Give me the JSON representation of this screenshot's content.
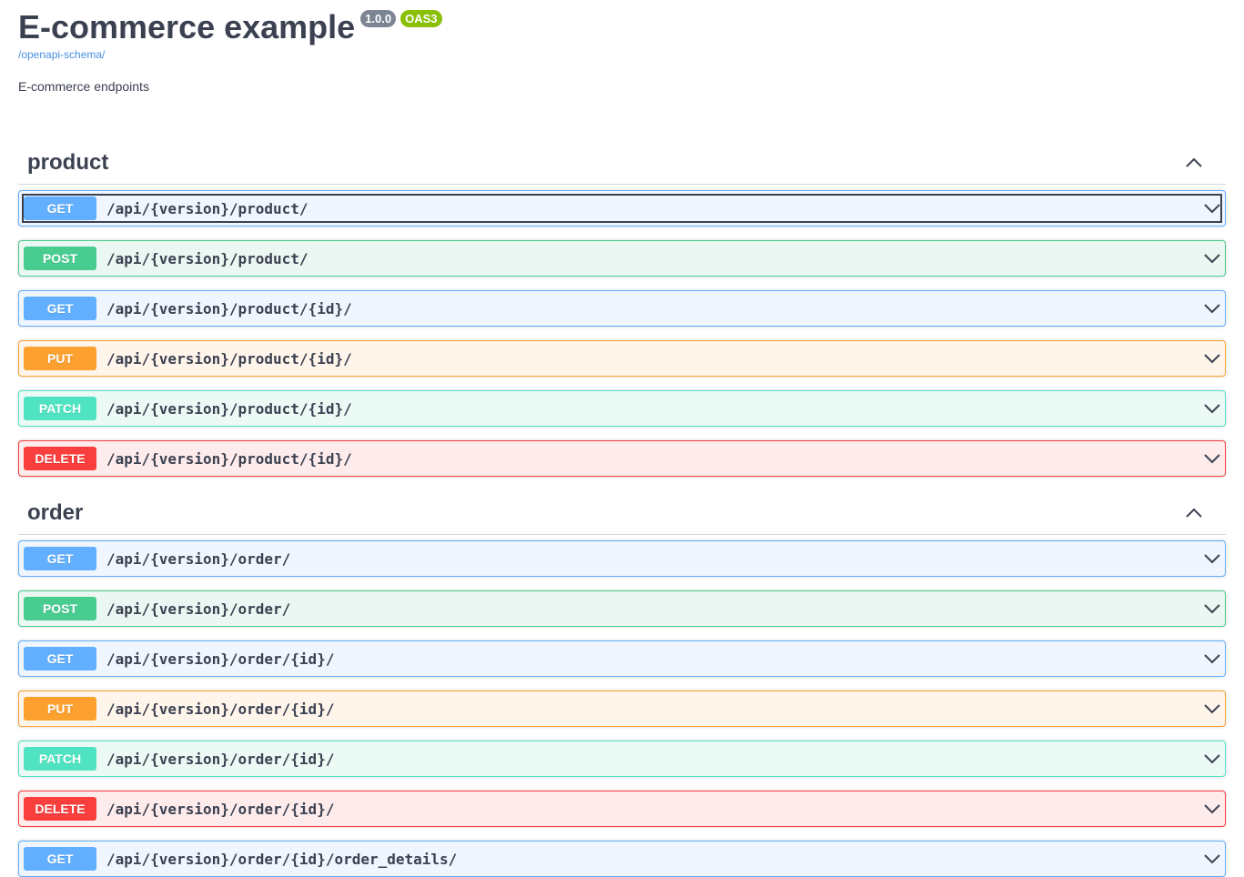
{
  "info": {
    "title": "E-commerce example",
    "version": "1.0.0",
    "oas": "OAS3",
    "schema_link": "/openapi-schema/",
    "description": "E-commerce endpoints"
  },
  "tags": [
    {
      "name": "product",
      "operations": [
        {
          "method": "GET",
          "path": "/api/{version}/product/"
        },
        {
          "method": "POST",
          "path": "/api/{version}/product/"
        },
        {
          "method": "GET",
          "path": "/api/{version}/product/{id}/"
        },
        {
          "method": "PUT",
          "path": "/api/{version}/product/{id}/"
        },
        {
          "method": "PATCH",
          "path": "/api/{version}/product/{id}/"
        },
        {
          "method": "DELETE",
          "path": "/api/{version}/product/{id}/"
        }
      ]
    },
    {
      "name": "order",
      "operations": [
        {
          "method": "GET",
          "path": "/api/{version}/order/"
        },
        {
          "method": "POST",
          "path": "/api/{version}/order/"
        },
        {
          "method": "GET",
          "path": "/api/{version}/order/{id}/"
        },
        {
          "method": "PUT",
          "path": "/api/{version}/order/{id}/"
        },
        {
          "method": "PATCH",
          "path": "/api/{version}/order/{id}/"
        },
        {
          "method": "DELETE",
          "path": "/api/{version}/order/{id}/"
        },
        {
          "method": "GET",
          "path": "/api/{version}/order/{id}/order_details/"
        }
      ]
    }
  ],
  "icons": {
    "tag_toggle": "chevron-up-icon",
    "op_toggle": "chevron-down-icon"
  },
  "colors": {
    "get": "#61affe",
    "post": "#49cc90",
    "put": "#fca130",
    "patch": "#50e3c2",
    "delete": "#f93e3e",
    "version_badge": "#7d8492",
    "oas_badge": "#89bf04",
    "link": "#4990e2"
  }
}
